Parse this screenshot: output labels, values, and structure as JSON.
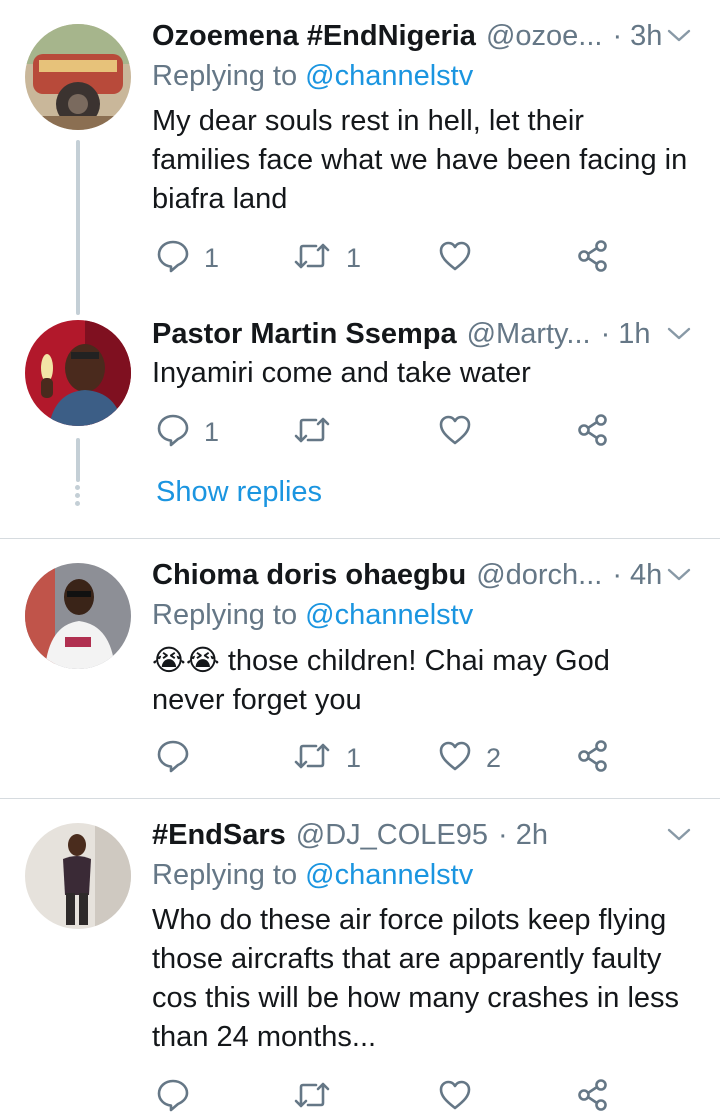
{
  "tweets": [
    {
      "name": "Ozoemena #EndNigeria",
      "handle": "@ozoe...",
      "time": "· 3h",
      "reply_prefix": "Replying to ",
      "reply_mention": "@channelstv",
      "text": "My dear souls rest in hell, let their families face what we have been facing in biafra land",
      "reply_count": "1",
      "retweet_count": "1",
      "like_count": ""
    },
    {
      "name": "Pastor Martin Ssempa",
      "handle": "@Marty...",
      "time": "· 1h",
      "text": "Inyamiri come and take water",
      "reply_count": "1",
      "retweet_count": "",
      "like_count": "",
      "show_replies": "Show replies"
    },
    {
      "name": "Chioma doris ohaegbu",
      "handle": "@dorch...",
      "time": "· 4h",
      "reply_prefix": "Replying to ",
      "reply_mention": "@channelstv",
      "emoji": "😭😭",
      "text": " those children! Chai may God never forget you",
      "reply_count": "",
      "retweet_count": "1",
      "like_count": "2"
    },
    {
      "name": "#EndSars",
      "handle": "@DJ_COLE95",
      "time": "· 2h",
      "reply_prefix": "Replying to ",
      "reply_mention": "@channelstv",
      "text": "Who do these air force pilots keep flying those aircrafts that are apparently faulty cos this will be how many crashes in less than 24 months...",
      "reply_count": "",
      "retweet_count": "",
      "like_count": ""
    }
  ],
  "colors": {
    "link": "#1b95e0",
    "muted": "#657786",
    "text": "#14171a",
    "thread_line": "#c4cfd6",
    "divider": "#d6dbdf"
  },
  "icons": [
    "reply-icon",
    "retweet-icon",
    "like-icon",
    "share-icon",
    "caret-down-icon"
  ]
}
